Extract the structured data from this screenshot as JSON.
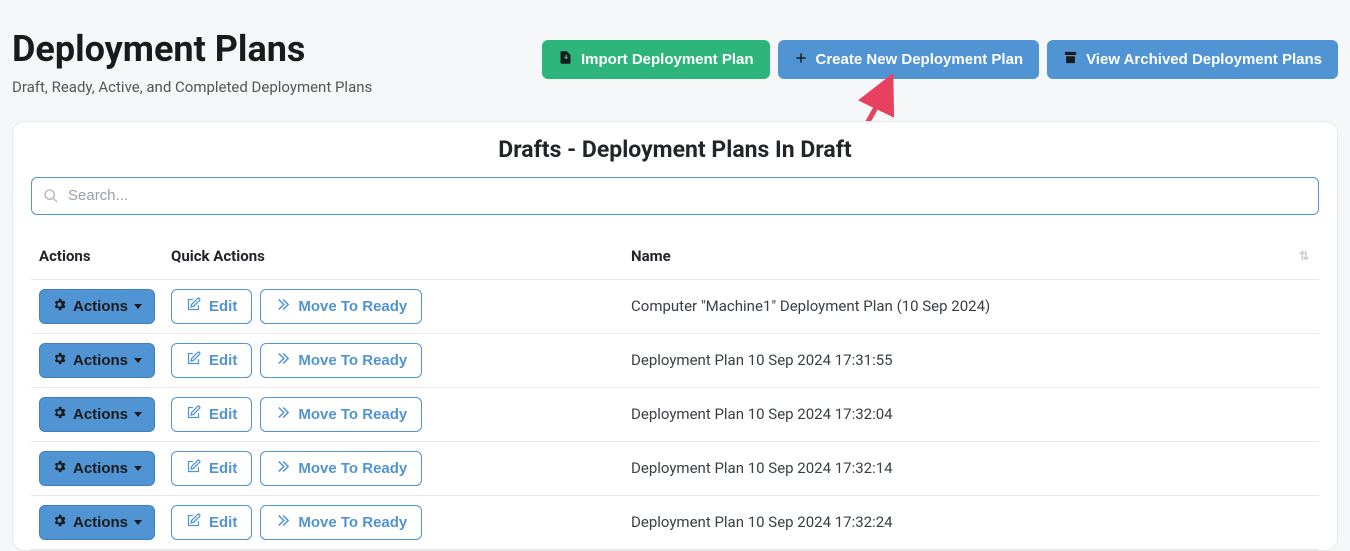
{
  "header": {
    "title": "Deployment Plans",
    "subtitle": "Draft, Ready, Active, and Completed Deployment Plans",
    "import_label": "Import Deployment Plan",
    "create_label": "Create New Deployment Plan",
    "archived_label": "View Archived Deployment Plans"
  },
  "panel": {
    "title": "Drafts - Deployment Plans In Draft",
    "search_placeholder": "Search..."
  },
  "table": {
    "col_actions": "Actions",
    "col_quick": "Quick Actions",
    "col_name": "Name",
    "actions_btn": "Actions",
    "edit_btn": "Edit",
    "move_btn": "Move To Ready",
    "rows": [
      {
        "name": "Computer \"Machine1\" Deployment Plan (10 Sep 2024)"
      },
      {
        "name": "Deployment Plan 10 Sep 2024 17:31:55"
      },
      {
        "name": "Deployment Plan 10 Sep 2024 17:32:04"
      },
      {
        "name": "Deployment Plan 10 Sep 2024 17:32:14"
      },
      {
        "name": "Deployment Plan 10 Sep 2024 17:32:24"
      }
    ]
  }
}
